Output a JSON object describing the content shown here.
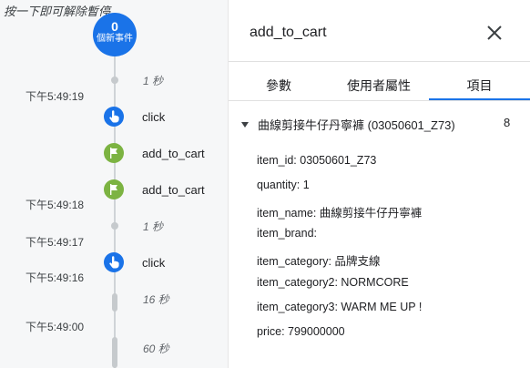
{
  "pause_hint": "按一下即可解除暫停",
  "counter": {
    "count": "0",
    "label": "個新事件"
  },
  "timeline": {
    "timestamps": [
      "下午5:49:19",
      "下午5:49:18",
      "下午5:49:17",
      "下午5:49:16",
      "下午5:49:00"
    ],
    "gaps": [
      "1 秒",
      "1 秒",
      "16 秒",
      "60 秒"
    ],
    "events": [
      {
        "name": "click",
        "type": "click"
      },
      {
        "name": "add_to_cart",
        "type": "flag"
      },
      {
        "name": "add_to_cart",
        "type": "flag"
      },
      {
        "name": "click",
        "type": "click"
      }
    ]
  },
  "panel": {
    "title": "add_to_cart",
    "tabs": [
      "參數",
      "使用者屬性",
      "項目"
    ],
    "active_tab": "項目",
    "item": {
      "header": "曲線剪接牛仔丹寧褲 (03050601_Z73)",
      "count": "8",
      "params": [
        "item_id: 03050601_Z73",
        "quantity: 1",
        "item_name: 曲線剪接牛仔丹寧褲",
        "item_brand:",
        "item_category: 品牌支線",
        "item_category2: NORMCORE",
        "item_category3: WARM ME UP !",
        "price: 799000000"
      ]
    }
  },
  "colors": {
    "accent": "#1a73e8",
    "flag": "#7cb342"
  }
}
